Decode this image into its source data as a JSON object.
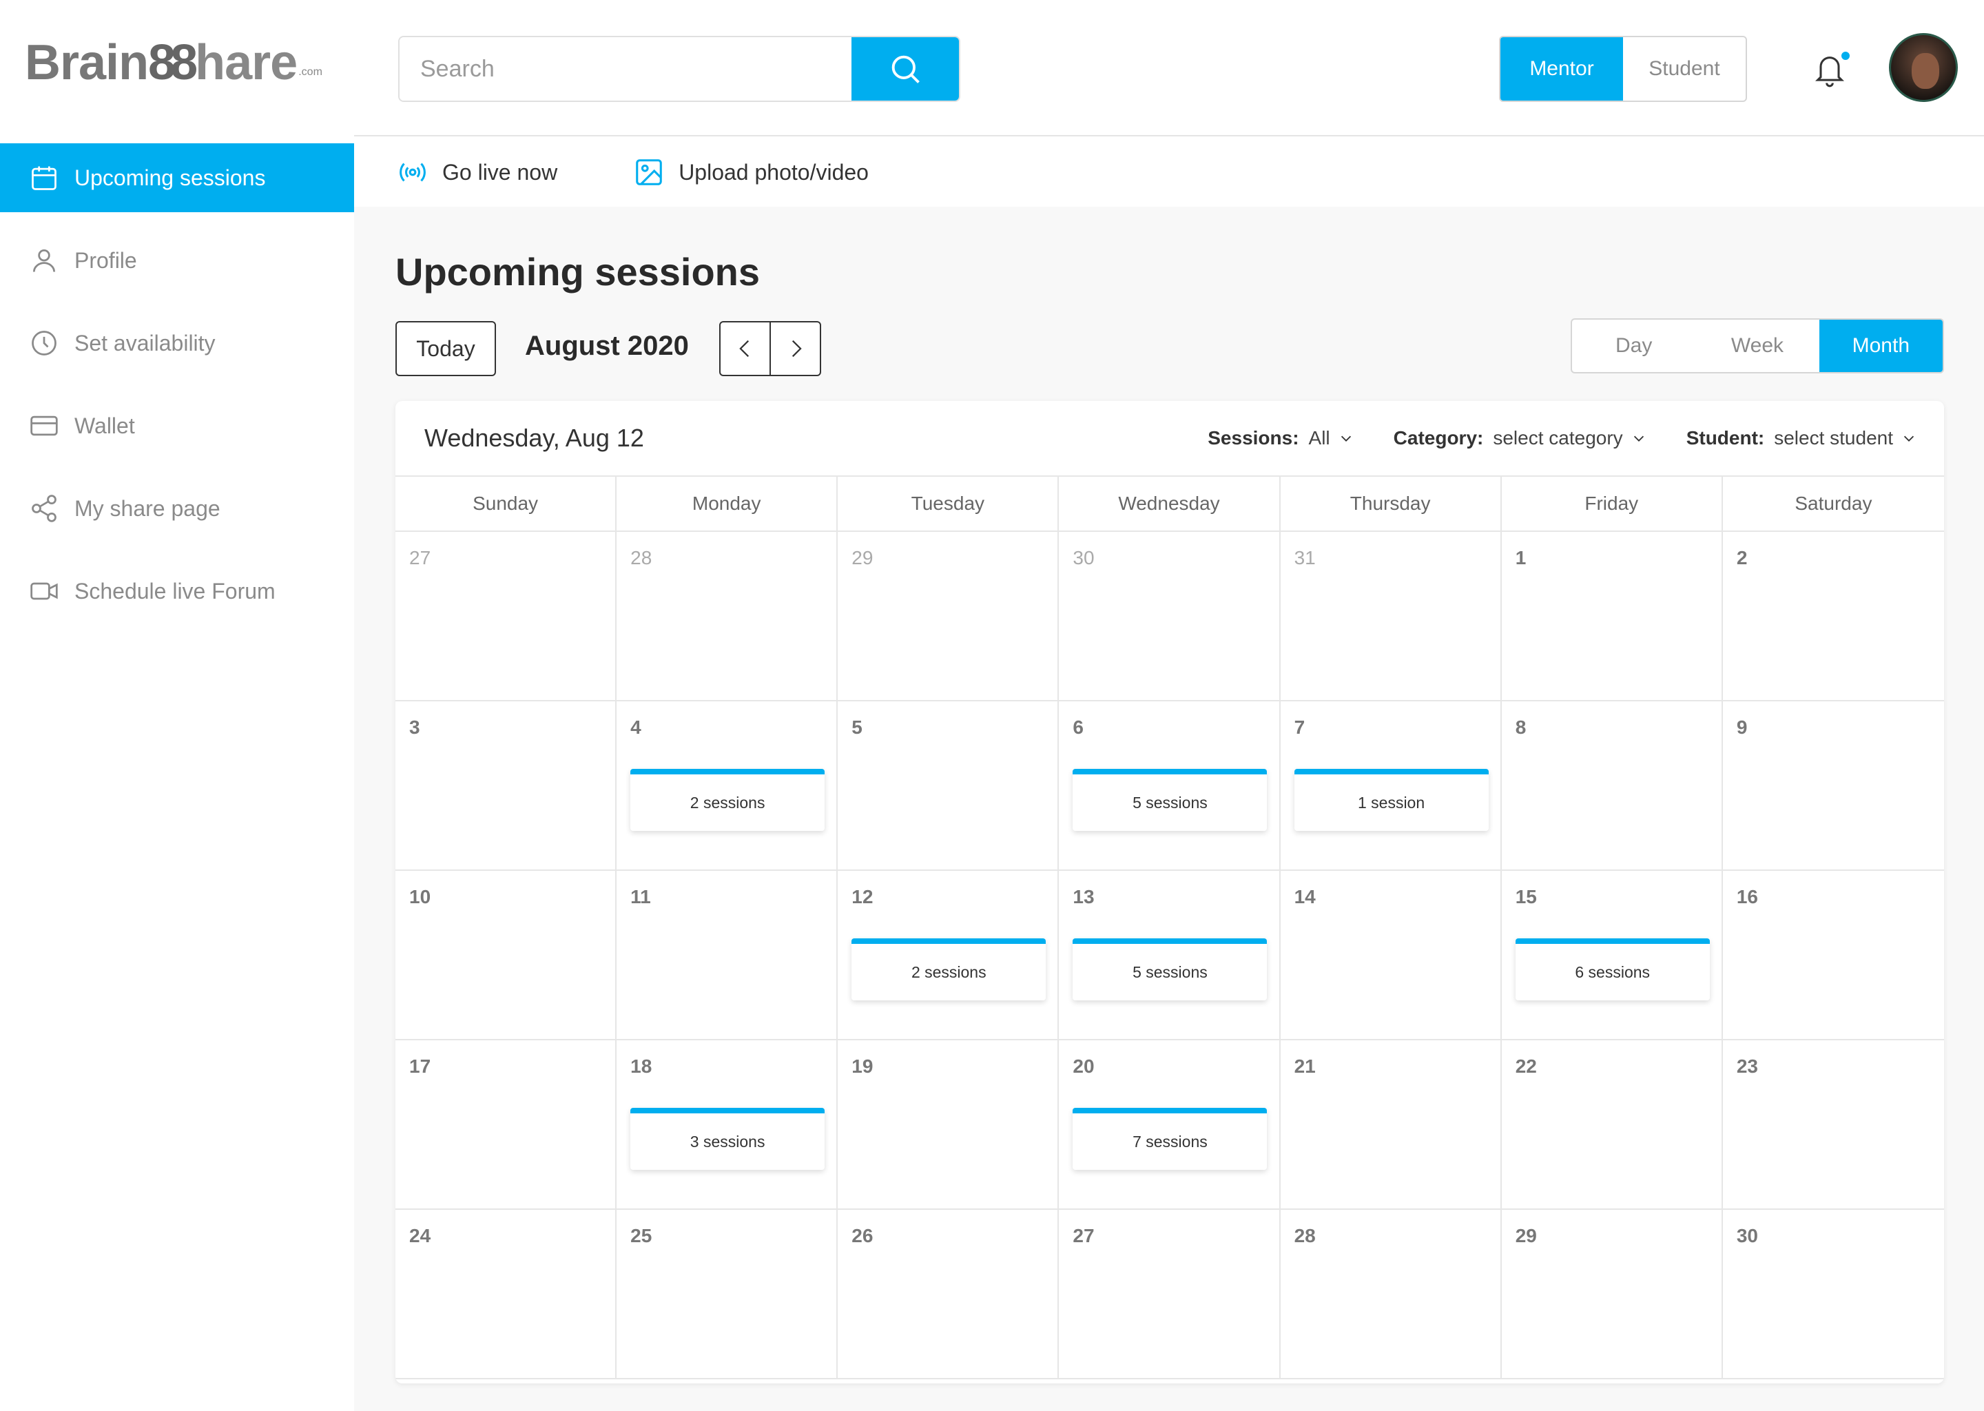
{
  "brand": {
    "part1": "Brain",
    "part2": "88",
    "part3": "hare",
    "suffix": ".com"
  },
  "sidebar": {
    "items": [
      {
        "label": "Upcoming sessions",
        "icon": "calendar-icon",
        "active": true
      },
      {
        "label": "Profile",
        "icon": "user-icon",
        "active": false
      },
      {
        "label": "Set availability",
        "icon": "clock-icon",
        "active": false
      },
      {
        "label": "Wallet",
        "icon": "credit-card-icon",
        "active": false
      },
      {
        "label": "My share page",
        "icon": "share-icon",
        "active": false
      },
      {
        "label": "Schedule live Forum",
        "icon": "video-camera-icon",
        "active": false
      }
    ]
  },
  "header": {
    "search_placeholder": "Search",
    "role_mentor": "Mentor",
    "role_student": "Student",
    "active_role": "Mentor"
  },
  "actions": {
    "go_live": "Go live now",
    "upload": "Upload photo/video"
  },
  "main": {
    "title": "Upcoming sessions",
    "today": "Today",
    "month": "August 2020",
    "views": [
      "Day",
      "Week",
      "Month"
    ],
    "active_view": "Month"
  },
  "calendar": {
    "selected_date": "Wednesday, Aug 12",
    "filters": [
      {
        "key": "Sessions:",
        "value": "All"
      },
      {
        "key": "Category:",
        "value": "select category"
      },
      {
        "key": "Student:",
        "value": "select student"
      }
    ],
    "weekdays": [
      "Sunday",
      "Monday",
      "Tuesday",
      "Wednesday",
      "Thursday",
      "Friday",
      "Saturday"
    ],
    "weeks": [
      [
        {
          "d": "27",
          "muted": true
        },
        {
          "d": "28",
          "muted": true
        },
        {
          "d": "29",
          "muted": true
        },
        {
          "d": "30",
          "muted": true
        },
        {
          "d": "31",
          "muted": true
        },
        {
          "d": "1"
        },
        {
          "d": "2"
        }
      ],
      [
        {
          "d": "3"
        },
        {
          "d": "4",
          "s": "2 sessions"
        },
        {
          "d": "5"
        },
        {
          "d": "6",
          "s": "5 sessions"
        },
        {
          "d": "7",
          "s": "1 session"
        },
        {
          "d": "8"
        },
        {
          "d": "9"
        }
      ],
      [
        {
          "d": "10"
        },
        {
          "d": "11"
        },
        {
          "d": "12",
          "s": "2 sessions"
        },
        {
          "d": "13",
          "s": "5 sessions"
        },
        {
          "d": "14"
        },
        {
          "d": "15",
          "s": "6 sessions"
        },
        {
          "d": "16"
        }
      ],
      [
        {
          "d": "17"
        },
        {
          "d": "18",
          "s": "3 sessions"
        },
        {
          "d": "19"
        },
        {
          "d": "20",
          "s": "7 sessions"
        },
        {
          "d": "21"
        },
        {
          "d": "22"
        },
        {
          "d": "23"
        }
      ],
      [
        {
          "d": "24"
        },
        {
          "d": "25"
        },
        {
          "d": "26"
        },
        {
          "d": "27"
        },
        {
          "d": "28"
        },
        {
          "d": "29"
        },
        {
          "d": "30"
        }
      ]
    ]
  },
  "colors": {
    "accent": "#00aeef",
    "background": "#f8f8f8"
  }
}
